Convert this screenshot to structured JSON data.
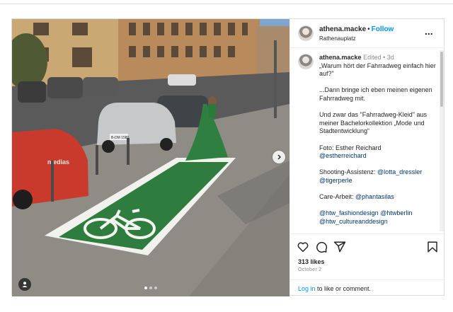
{
  "header": {
    "username": "athena.macke",
    "separator": "•",
    "follow_label": "Follow",
    "location": "Rathenauplatz",
    "more_label": "..."
  },
  "caption": {
    "username": "athena.macke",
    "edited_label": "Edited",
    "separator": "•",
    "time_ago": "3d",
    "p1": "„Warum hört der Fahrradweg einfach hier auf?\"",
    "p2": "...Dann bringe ich eben meinen eigenen Fahrradweg mit.",
    "p3": "Und zwar das \"Fahrradweg-Kleid\" aus meiner Bachelorkollektion „Mode und Stadtentwicklung“",
    "photo_credit_label": "Foto: Esther Reichard",
    "photo_credit_handle": "@estherreichard",
    "assist_label": "Shooting-Assistenz: ",
    "assist_handle_1": "@lotta_dressler",
    "assist_handle_2": "@tigerperle",
    "care_label": "Care-Arbeit: ",
    "care_handle": "@phantasilas",
    "tag_1": "@htw_fashiondesign",
    "tag_2": "@htwberlin",
    "tag_3": "@htw_cultureanddesign"
  },
  "photo": {
    "license_plate": "B-DM 1580",
    "car_text": "medias",
    "carousel_dots": 3,
    "active_dot": 0
  },
  "engagement": {
    "likes": "313 likes",
    "date": "October 2",
    "login_link": "Log in",
    "login_suffix": " to like or comment."
  },
  "colors": {
    "accent": "#0095f6",
    "dress_green": "#2e7d3e",
    "border": "#dbdbdb"
  }
}
